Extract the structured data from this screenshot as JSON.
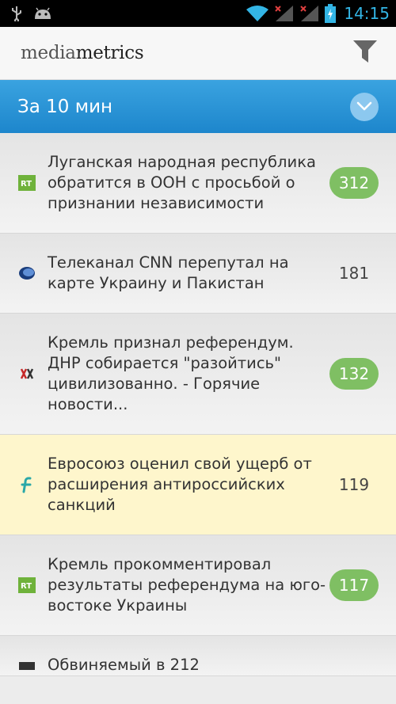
{
  "status_bar": {
    "time": "14:15",
    "icons": [
      "usb-icon",
      "android-icon",
      "wifi-icon",
      "signal-icon",
      "signal-icon",
      "battery-charging-icon"
    ]
  },
  "header": {
    "brand_light": "media",
    "brand_bold": "metrics",
    "filter_icon": "filter-icon"
  },
  "period": {
    "label": "За 10 мин",
    "toggle_icon": "chevron-down-icon"
  },
  "colors": {
    "accent": "#1d86cc",
    "badge": "#7fbf63",
    "highlight": "#fef6cc",
    "status_icon": "#33b5e5"
  },
  "news": [
    {
      "source_icon": "rt-logo-icon",
      "title": "Луганская народная республика обратится в ООН с просьбой о признании независимости",
      "count": "312",
      "badge": true,
      "highlight": false
    },
    {
      "source_icon": "globe-logo-icon",
      "title": "Телеканал CNN перепутал на карте Украину и Пакистан",
      "count": "181",
      "badge": false,
      "highlight": false
    },
    {
      "source_icon": "red-mark-logo-icon",
      "title": "Кремль признал референдум. ДНР собирается \"разойтись\" цивилизованно. - Горячие новости...",
      "count": "132",
      "badge": true,
      "highlight": false
    },
    {
      "source_icon": "f-logo-icon",
      "title": "Евросоюз оценил свой ущерб от расширения антироссийских санкций",
      "count": "119",
      "badge": false,
      "highlight": true
    },
    {
      "source_icon": "rt-logo-icon",
      "title": "Кремль прокомментировал результаты референдума на юго-востоке Украины",
      "count": "117",
      "badge": true,
      "highlight": false
    },
    {
      "source_icon": "dark-logo-icon",
      "title": "Обвиняемый в 212",
      "count": "",
      "badge": false,
      "highlight": false
    }
  ]
}
